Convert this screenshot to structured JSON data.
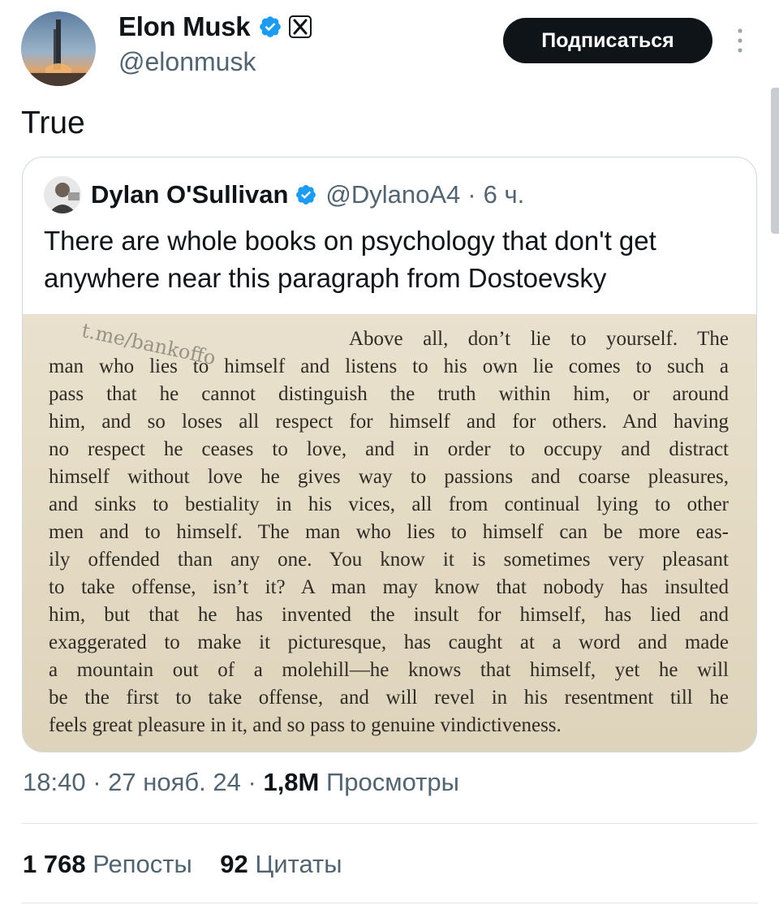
{
  "author": {
    "display_name": "Elon Musk",
    "handle": "@elonmusk",
    "avatar_icon": "rocket-launch-avatar",
    "verified_icon": "verified-badge-icon",
    "affiliation_icon": "x-logo-icon"
  },
  "header": {
    "subscribe_label": "Подписаться",
    "more_icon": "more-vertical-icon"
  },
  "tweet": {
    "text": "True"
  },
  "quote": {
    "display_name": "Dylan O'Sullivan",
    "handle": "@DylanoA4",
    "separator": "·",
    "time": "6 ч.",
    "text": "There are whole books on psychology that don't get anywhere near this paragraph from Dostoevsky",
    "image": {
      "watermark": "t.me/bankoffo",
      "lines": [
        "Above all, don’t lie to yourself.  The",
        "man who lies to himself and listens to his own lie comes to such a",
        "pass that he cannot distinguish the truth within him, or around",
        "him, and so loses all respect for himself and for others.  And having",
        "no respect he ceases to love, and in order to occupy and distract",
        "himself without love he gives way to passions and coarse pleasures,",
        "and sinks to bestiality in his vices, all from continual lying to other",
        "men and to himself.  The man who lies to himself can be more eas-",
        "ily offended than any one.  You know it is sometimes very pleasant",
        "to take offense, isn’t it?  A man may know that nobody has insulted",
        "him, but that he has invented the insult for himself, has lied and",
        "exaggerated to make it picturesque, has caught at a word and made",
        "a mountain out of a molehill—he knows that himself, yet he will",
        "be the first to take offense, and will revel in his resentment till he",
        "feels great pleasure in it, and so pass to genuine vindictiveness."
      ]
    }
  },
  "meta": {
    "time": "18:40",
    "separator": "·",
    "date": "27 нояб. 24",
    "views_count": "1,8M",
    "views_label": "Просмотры"
  },
  "stats": {
    "reposts_count": "1 768",
    "reposts_label": "Репосты",
    "quotes_count": "92",
    "quotes_label": "Цитаты"
  },
  "colors": {
    "verified": "#1d9bf0",
    "text": "#0f1419",
    "secondary": "#536471",
    "page_bg": "#e5dcc7"
  }
}
